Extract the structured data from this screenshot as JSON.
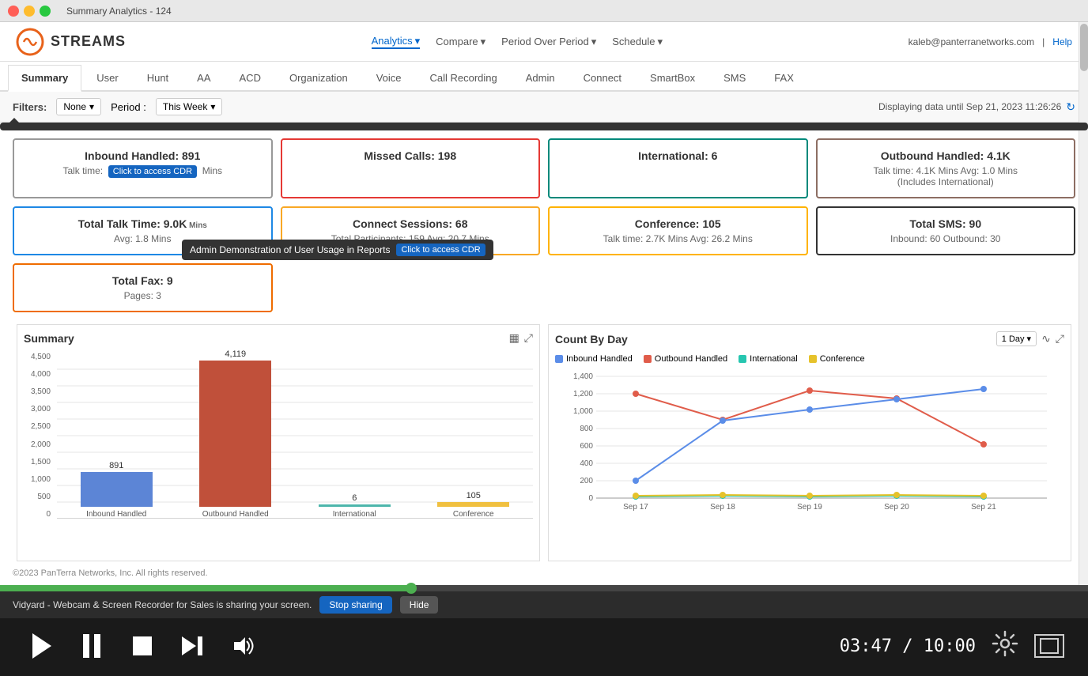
{
  "browser": {
    "title": "Summary Analytics - 124"
  },
  "header": {
    "logo_text": "STREAMS",
    "nav": [
      {
        "label": "Analytics",
        "active": true,
        "has_dropdown": true
      },
      {
        "label": "Compare",
        "has_dropdown": true
      },
      {
        "label": "Period Over Period",
        "has_dropdown": true
      },
      {
        "label": "Schedule",
        "has_dropdown": true
      }
    ],
    "user_email": "kaleb@panterranetworks.com",
    "help_label": "Help"
  },
  "tabs": [
    {
      "label": "Summary",
      "active": true
    },
    {
      "label": "User"
    },
    {
      "label": "Hunt"
    },
    {
      "label": "AA"
    },
    {
      "label": "ACD"
    },
    {
      "label": "Organization"
    },
    {
      "label": "Voice"
    },
    {
      "label": "Call Recording"
    },
    {
      "label": "Admin"
    },
    {
      "label": "Connect"
    },
    {
      "label": "SmartBox"
    },
    {
      "label": "SMS"
    },
    {
      "label": "FAX"
    }
  ],
  "filters": {
    "label": "Filters:",
    "none_label": "None",
    "period_label": "Period :",
    "this_week_label": "This Week",
    "displaying": "Displaying data until Sep 21, 2023 11:26:26"
  },
  "tooltip": {
    "text": "Admin Demonstration of User Usage in Reports",
    "cdr_label": "Click to access CDR"
  },
  "cards": [
    {
      "id": "inbound-handled",
      "title": "Inbound Handled: 891",
      "subtitle": "Talk time:",
      "subtitle2": "Mins",
      "border": "gray"
    },
    {
      "id": "missed-calls",
      "title": "Missed Calls: 198",
      "subtitle": "",
      "border": "red"
    },
    {
      "id": "international",
      "title": "International: 6",
      "subtitle": "",
      "border": "teal"
    },
    {
      "id": "outbound-handled",
      "title": "Outbound Handled: 4.1K",
      "subtitle": "Talk time: 4.1K Mins  Avg: 1.0 Mins",
      "subtitle2": "(Includes International)",
      "border": "brown"
    },
    {
      "id": "total-talk-time",
      "title": "Total Talk Time: 9.0K",
      "title_unit": "Mins",
      "subtitle": "Avg: 1.8 Mins",
      "border": "blue"
    },
    {
      "id": "connect-sessions",
      "title": "Connect Sessions: 68",
      "subtitle": "Total Participants: 159  Avg: 20.7 Mins",
      "border": "yellow"
    },
    {
      "id": "conference",
      "title": "Conference: 105",
      "subtitle": "Talk time: 2.7K Mins  Avg: 26.2 Mins",
      "border": "yellow2"
    },
    {
      "id": "total-sms",
      "title": "Total SMS: 90",
      "subtitle": "Inbound: 60  Outbound: 30",
      "border": "black"
    },
    {
      "id": "total-fax",
      "title": "Total Fax: 9",
      "subtitle": "Pages: 3",
      "border": "orange",
      "wide": false
    }
  ],
  "summary_chart": {
    "title": "Summary",
    "y_axis": [
      "0",
      "500",
      "1,000",
      "1,500",
      "2,000",
      "2,500",
      "3,000",
      "3,500",
      "4,000",
      "4,500"
    ],
    "bars": [
      {
        "label": "Inbound Handled",
        "value": 891,
        "height_pct": 21,
        "color": "#5c85d6"
      },
      {
        "label": "Outbound Handled",
        "value": 4119,
        "height_pct": 97,
        "color": "#c0503a"
      },
      {
        "label": "International",
        "value": 6,
        "height_pct": 1,
        "color": "#4db6ac"
      },
      {
        "label": "Conference",
        "value": 105,
        "height_pct": 3,
        "color": "#f0c040"
      }
    ]
  },
  "count_by_day_chart": {
    "title": "Count By Day",
    "period_label": "1 Day",
    "legend": [
      {
        "label": "Inbound Handled",
        "color": "#5b8de8"
      },
      {
        "label": "Outbound Handled",
        "color": "#e05c4a"
      },
      {
        "label": "International",
        "color": "#26c6b0"
      },
      {
        "label": "Conference",
        "color": "#e6c22b"
      }
    ],
    "x_labels": [
      "Sep 17",
      "Sep 18",
      "Sep 19",
      "Sep 20",
      "Sep 21"
    ],
    "y_axis": [
      "0",
      "200",
      "400",
      "600",
      "800",
      "1,000",
      "1,200",
      "1,400"
    ],
    "series": [
      {
        "name": "Outbound Handled",
        "color": "#e05c4a",
        "points": [
          {
            "x": 0,
            "y": 1200
          },
          {
            "x": 1,
            "y": 900
          },
          {
            "x": 2,
            "y": 1240
          },
          {
            "x": 3,
            "y": 1150
          },
          {
            "x": 4,
            "y": 620
          }
        ]
      },
      {
        "name": "Inbound Handled",
        "color": "#5b8de8",
        "points": [
          {
            "x": 0,
            "y": 200
          },
          {
            "x": 1,
            "y": 890
          },
          {
            "x": 2,
            "y": 1020
          },
          {
            "x": 3,
            "y": 1140
          },
          {
            "x": 4,
            "y": 1260
          }
        ]
      },
      {
        "name": "International",
        "color": "#26c6b0",
        "points": [
          {
            "x": 0,
            "y": 10
          },
          {
            "x": 1,
            "y": 20
          },
          {
            "x": 2,
            "y": 15
          },
          {
            "x": 3,
            "y": 18
          },
          {
            "x": 4,
            "y": 12
          }
        ]
      },
      {
        "name": "Conference",
        "color": "#e6c22b",
        "points": [
          {
            "x": 0,
            "y": 30
          },
          {
            "x": 1,
            "y": 35
          },
          {
            "x": 2,
            "y": 28
          },
          {
            "x": 3,
            "y": 32
          },
          {
            "x": 4,
            "y": 25
          }
        ]
      }
    ]
  },
  "vidyard": {
    "message": "Vidyard - Webcam & Screen Recorder for Sales is sharing your screen.",
    "stop_label": "Stop sharing",
    "hide_label": "Hide"
  },
  "player": {
    "current_time": "03:47",
    "total_time": "10:00",
    "progress_pct": 37.8
  },
  "footer": {
    "copyright": "©2023 PanTerra Networks, Inc. All rights reserved."
  }
}
